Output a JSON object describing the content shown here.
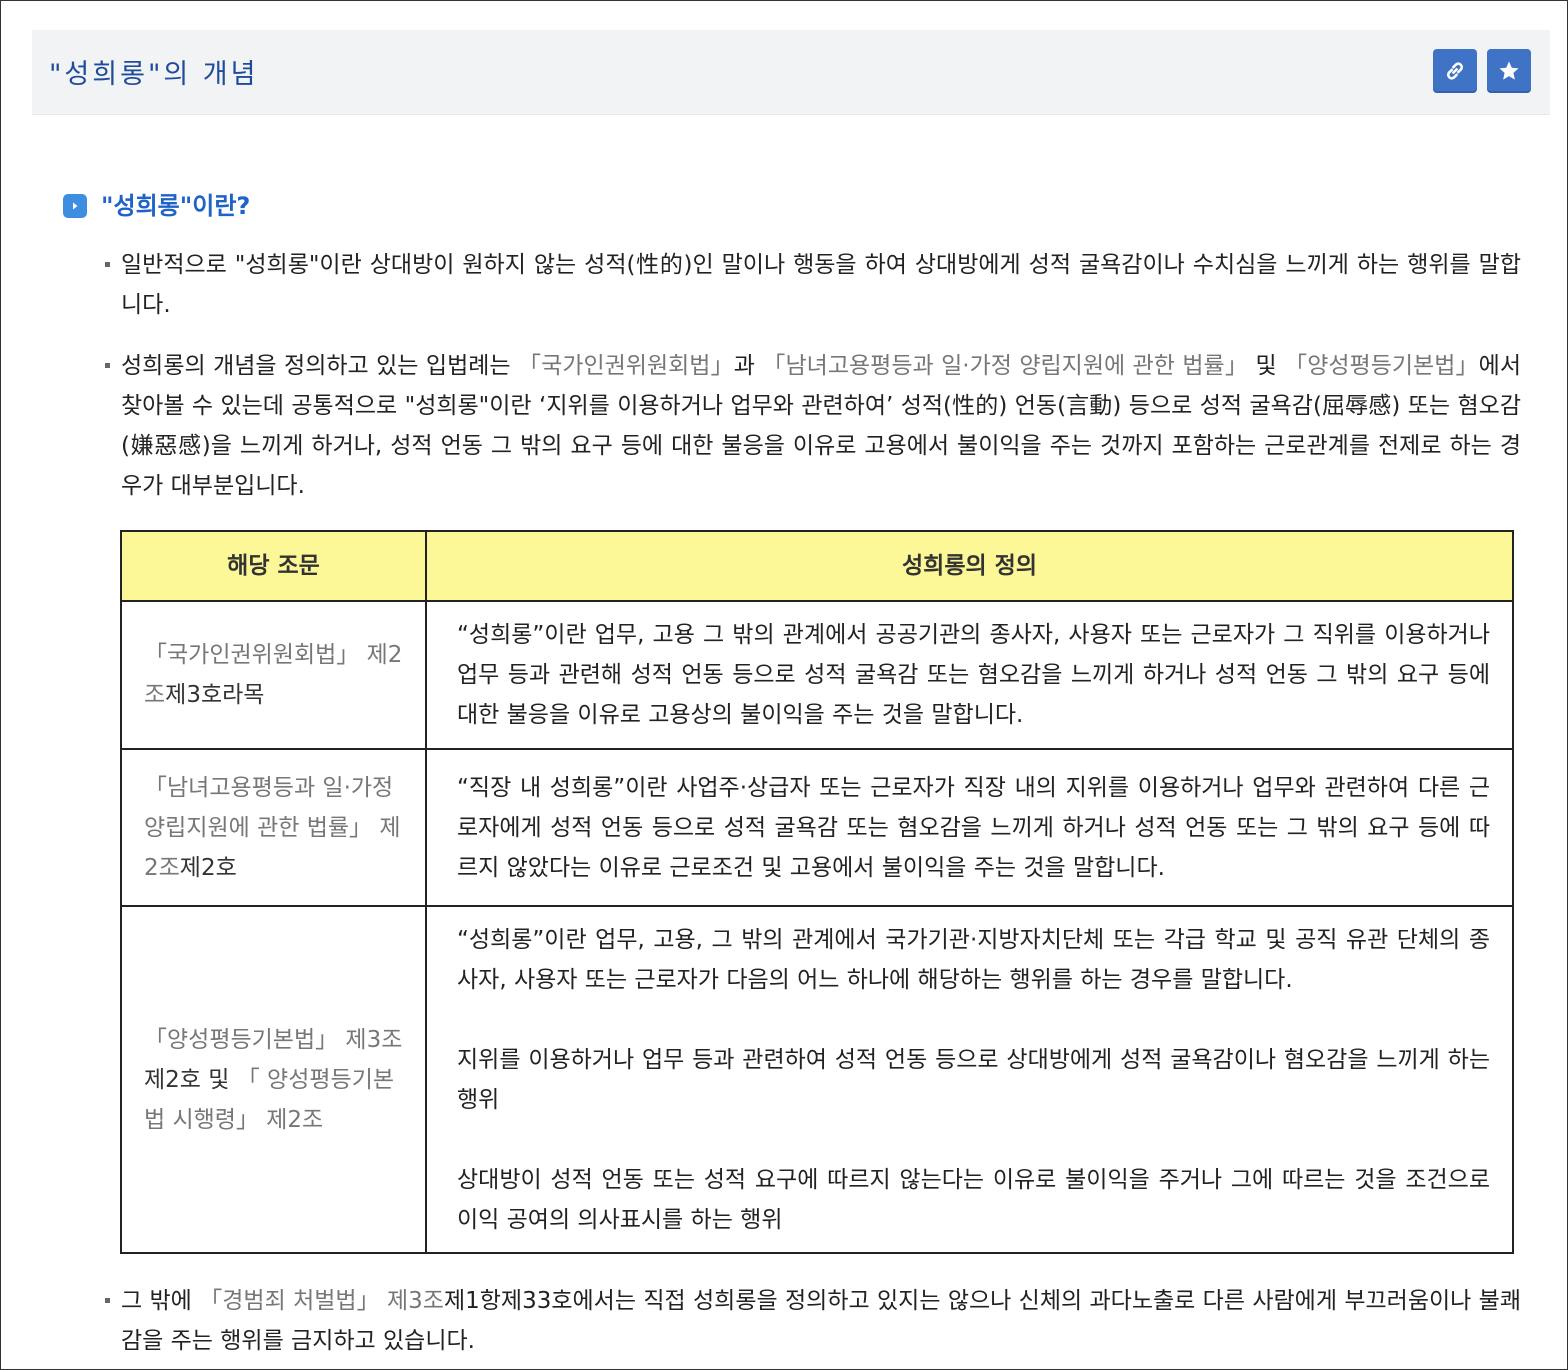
{
  "header": {
    "title": "\"성희롱\"의 개념",
    "link_icon": "link-icon",
    "star_icon": "star-icon",
    "accent_color": "#3f73c6"
  },
  "section": {
    "heading": "\"성희롱\"이란?",
    "heading_icon": "play-icon",
    "heading_color": "#1e63c7"
  },
  "paragraphs": {
    "p1": "일반적으로 \"성희롱\"이란 상대방이 원하지 않는 성적(性的)인 말이나 행동을 하여 상대방에게 성적 굴욕감이나 수치심을 느끼게 하는 행위를 말합니다.",
    "p2_part1": "성희롱의 개념을 정의하고 있는 입법례는 ",
    "p2_law1": "「국가인권위원회법」",
    "p2_part2": "과 ",
    "p2_law2": "「남녀고용평등과 일·가정 양립지원에 관한 법률」",
    "p2_part3": " 및 ",
    "p2_law3": "「양성평등기본법」",
    "p2_part4": "에서 찾아볼 수 있는데 공통적으로 \"성희롱\"이란 ‘지위를 이용하거나 업무와 관련하여’ 성적(性的) 언동(言動) 등으로 성적 굴욕감(屈辱感) 또는 혐오감(嫌惡感)을 느끼게 하거나, 성적 언동 그 밖의 요구 등에 대한 불응을 이유로 고용에서 불이익을 주는 것까지 포함하는 근로관계를 전제로 하는 경우가 대부분입니다.",
    "p3_part1": "그 밖에 ",
    "p3_law": "「경범죄 처벌법」 제3조",
    "p3_part2": "제1항제33호에서는 직접 성희롱을 정의하고 있지는 않으나 신체의 과다노출로 다른 사람에게 부끄러움이나 불쾌감을 주는 행위를 금지하고 있습니다."
  },
  "table": {
    "headers": [
      "해당 조문",
      "성희롱의 정의"
    ],
    "header_bg": "#fcf897",
    "rows": [
      {
        "law_link": "「국가인권위원회법」 제2조",
        "law_plain": "제3호라목",
        "definition": [
          "“성희롱”이란 업무, 고용 그 밖의 관계에서 공공기관의 종사자, 사용자 또는 근로자가 그 직위를 이용하거나 업무 등과 관련해 성적 언동 등으로 성적 굴욕감 또는 혐오감을 느끼게 하거나 성적 언동 그 밖의 요구 등에 대한 불응을 이유로 고용상의 불이익을 주는 것을 말합니다."
        ]
      },
      {
        "law_link": "「남녀고용평등과 일·가정 양립지원에 관한 법률」 제2조",
        "law_plain": "제2호",
        "definition": [
          "“직장 내 성희롱”이란 사업주·상급자 또는 근로자가 직장 내의 지위를 이용하거나 업무와 관련하여 다른 근로자에게 성적 언동 등으로 성적 굴욕감 또는 혐오감을 느끼게 하거나 성적 언동 또는 그 밖의 요구 등에 따르지 않았다는 이유로 근로조건 및 고용에서 불이익을 주는 것을 말합니다."
        ]
      },
      {
        "law_link": "「양성평등기본법」 제3조",
        "law_plain": "제2호 및 ",
        "law_link2": "「 양성평등기본법 시행령」 제2조",
        "definition": [
          "“성희롱”이란 업무, 고용, 그 밖의 관계에서 국가기관·지방자치단체 또는 각급 학교 및 공직 유관 단체의 종사자, 사용자 또는 근로자가 다음의 어느 하나에 해당하는 행위를 하는 경우를 말합니다.",
          "지위를 이용하거나 업무 등과 관련하여 성적 언동 등으로 상대방에게 성적 굴욕감이나 혐오감을 느끼게 하는 행위",
          "상대방이 성적 언동 또는 성적 요구에 따르지 않는다는 이유로 불이익을 주거나 그에 따르는 것을 조건으로 이익 공여의 의사표시를 하는 행위"
        ]
      }
    ]
  }
}
